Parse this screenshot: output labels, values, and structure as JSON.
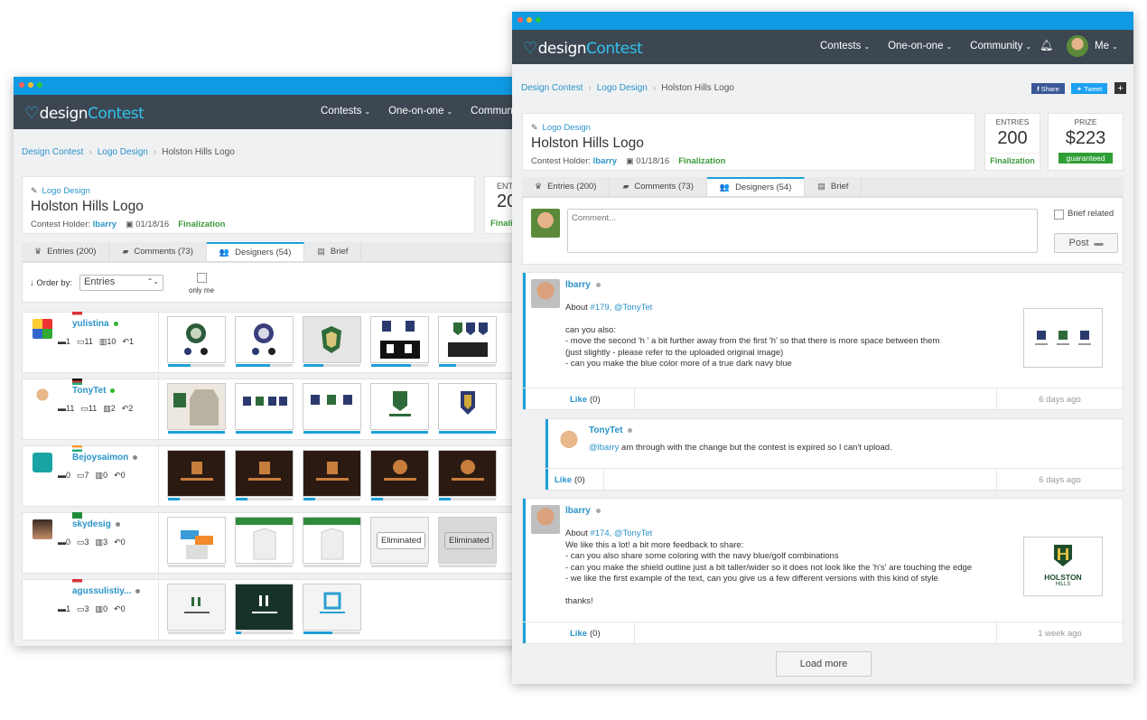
{
  "brand": {
    "part1": "design",
    "part2": "Contest"
  },
  "back_window": {
    "nav": [
      "Contests",
      "One-on-one",
      "Communit"
    ],
    "breadcrumb": [
      "Design Contest",
      "Logo Design",
      "Holston Hills Logo"
    ],
    "category": "Logo Design",
    "title": "Holston Hills Logo",
    "holder_label": "Contest Holder:",
    "holder": "lbarry",
    "date": "01/18/16",
    "status": "Finalization",
    "entries_peek_label": "ENT",
    "entries_peek_value": "20",
    "finalization_peek": "Finali",
    "tabs": [
      {
        "label": "Entries (200)",
        "icon": "trophy-icon"
      },
      {
        "label": "Comments (73)",
        "icon": "comments-icon"
      },
      {
        "label": "Designers (54)",
        "icon": "users-icon"
      },
      {
        "label": "Brief",
        "icon": "book-icon"
      }
    ],
    "order_label": "Order by:",
    "order_value": "Entries",
    "only_me_label": "only me",
    "eliminated_label": "Eliminated",
    "designers": [
      {
        "name": "yulistina",
        "online": true,
        "stats": [
          "1",
          "11",
          "10",
          "1"
        ]
      },
      {
        "name": "TonyTet",
        "online": true,
        "stats": [
          "11",
          "11",
          "2",
          "2"
        ]
      },
      {
        "name": "Bejoysaimon",
        "online": false,
        "stats": [
          "0",
          "7",
          "0",
          "0"
        ]
      },
      {
        "name": "skydesig",
        "online": false,
        "stats": [
          "0",
          "3",
          "3",
          "0"
        ]
      },
      {
        "name": "agussulistiy...",
        "online": false,
        "stats": [
          "1",
          "3",
          "0",
          "0"
        ]
      }
    ]
  },
  "front_window": {
    "nav": [
      "Contests",
      "One-on-one",
      "Community",
      "Me"
    ],
    "breadcrumb": [
      "Design Contest",
      "Logo Design",
      "Holston Hills Logo"
    ],
    "share_fb": "Share",
    "share_tw": "Tweet",
    "category": "Logo Design",
    "title": "Holston Hills Logo",
    "holder_label": "Contest Holder:",
    "holder": "lbarry",
    "date": "01/18/16",
    "status": "Finalization",
    "entries_label": "ENTRIES",
    "entries_value": "200",
    "prize_label": "PRIZE",
    "prize_value": "$223",
    "prize_badge": "guaranteed",
    "tabs": [
      {
        "label": "Entries (200)"
      },
      {
        "label": "Comments (73)"
      },
      {
        "label": "Designers (54)"
      },
      {
        "label": "Brief"
      }
    ],
    "comment_placeholder": "Comment...",
    "brief_related": "Brief related",
    "post_button": "Post",
    "posts": [
      {
        "author": "lbarry",
        "about_prefix": "About",
        "about_links": "#179, @TonyTet",
        "lines": [
          "can you also:",
          "- move the second 'h ' a bit further away from the first 'h' so that there is more space between them",
          "(just slightly - please refer to the uploaded original image)",
          "- can you make the blue color more of a true dark navy blue"
        ],
        "like_label": "Like",
        "like_count": "(0)",
        "ago": "6 days ago"
      },
      {
        "author": "TonyTet",
        "mention": "@lbarry",
        "text": "am through with the change but the contest is expired so I can't upload.",
        "like_label": "Like",
        "like_count": "(0)",
        "ago": "6 days ago"
      },
      {
        "author": "lbarry",
        "about_prefix": "About",
        "about_links": "#174, @TonyTet",
        "lines": [
          "We like this a lot! a bit more feedback to share:",
          "- can you also share some coloring with the navy blue/golf combinations",
          "- can you make the shield outline just a bit taller/wider so it does not look like the 'h's' are touching the  edge",
          "- we like the first example of the text, can you give us a few different versions with this kind of style",
          "",
          "thanks!"
        ],
        "attachment_text": [
          "HOLSTON",
          "HILLS"
        ],
        "like_label": "Like",
        "like_count": "(0)",
        "ago": "1 week ago"
      }
    ],
    "load_more": "Load more"
  },
  "colors": {
    "accent": "#1d9fd8",
    "navbar": "#3c4752",
    "titlebar": "#0f9be3",
    "finalization": "#3b9a3b",
    "prize_badge": "#2f9e35",
    "online": "#2cb52c"
  }
}
